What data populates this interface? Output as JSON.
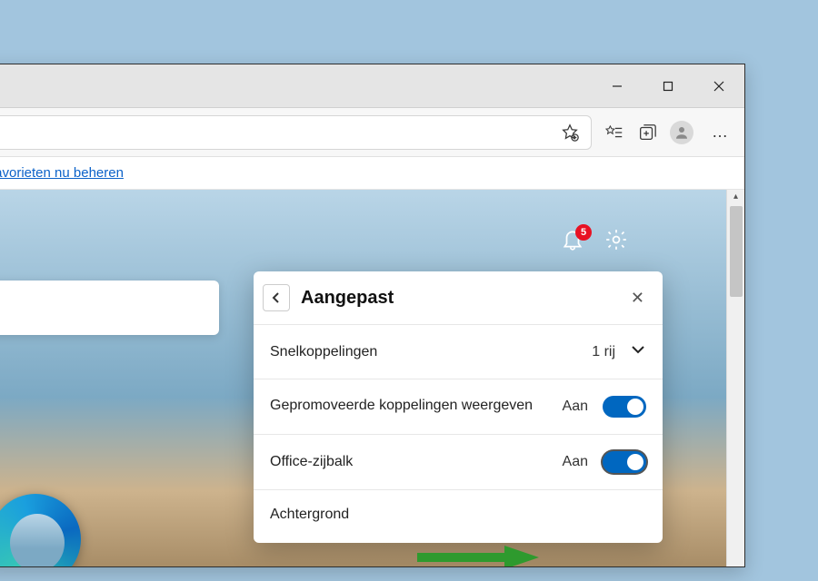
{
  "infobar": {
    "favorites_link": "Favorieten nu beheren"
  },
  "ntp": {
    "badge_count": "5"
  },
  "popup": {
    "title": "Aangepast",
    "rows": {
      "shortcuts_label": "Snelkoppelingen",
      "shortcuts_value": "1 rij",
      "promoted_label": "Gepromoveerde koppelingen weergeven",
      "promoted_value": "Aan",
      "office_label": "Office-zijbalk",
      "office_value": "Aan",
      "background_label": "Achtergrond"
    }
  }
}
